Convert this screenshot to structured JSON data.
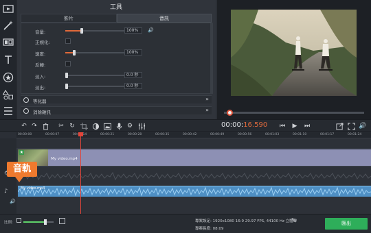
{
  "panel": {
    "title": "工具",
    "tab_video": "影片",
    "tab_audio": "音訊",
    "rows": [
      {
        "label": "音量:",
        "value": "100%",
        "level": 0.2
      },
      {
        "label": "正規化:"
      },
      {
        "label": "速度:",
        "value": "100%",
        "level": 0.1
      },
      {
        "label": "反轉:"
      },
      {
        "label": "淡入:",
        "value": "0.0 秒",
        "level": 0.0
      },
      {
        "label": "淡出:",
        "value": "0.0 秒",
        "level": 0.0
      }
    ],
    "accordions": [
      "等化器",
      "消除雜訊"
    ]
  },
  "preview": {
    "progress": 0.03
  },
  "toolbar": {
    "timecode_main": "00:00:",
    "timecode_ms": "16.590"
  },
  "ruler": {
    "ticks": [
      "00:00:00",
      "00:00:07",
      "00:00:14",
      "00:00:21",
      "00:00:28",
      "00:00:35",
      "00:00:42",
      "00:00:49",
      "00:00:56",
      "00:01:03",
      "00:01:10",
      "00:01:17",
      "00:01:24"
    ]
  },
  "timeline": {
    "video_clip_label": "My video.mp4",
    "audio_clip_label": "My video.mp4",
    "audio_callout": "音軌"
  },
  "bottom": {
    "scale_label": "比例:",
    "zoom_level": 0.72,
    "project_settings": "專案設定:  1920x1080 16:9 29.97 FPS, 44100 Hz 立體聲",
    "project_length": "專案長度:  08:09",
    "export_label": "匯出"
  },
  "colors": {
    "accent_orange": "#e26a3a",
    "playhead_red": "#e0453a",
    "export_green": "#2eae5a",
    "audio_clip_blue": "#4e8fc4",
    "video_clip_lavender": "#8d90b4"
  }
}
